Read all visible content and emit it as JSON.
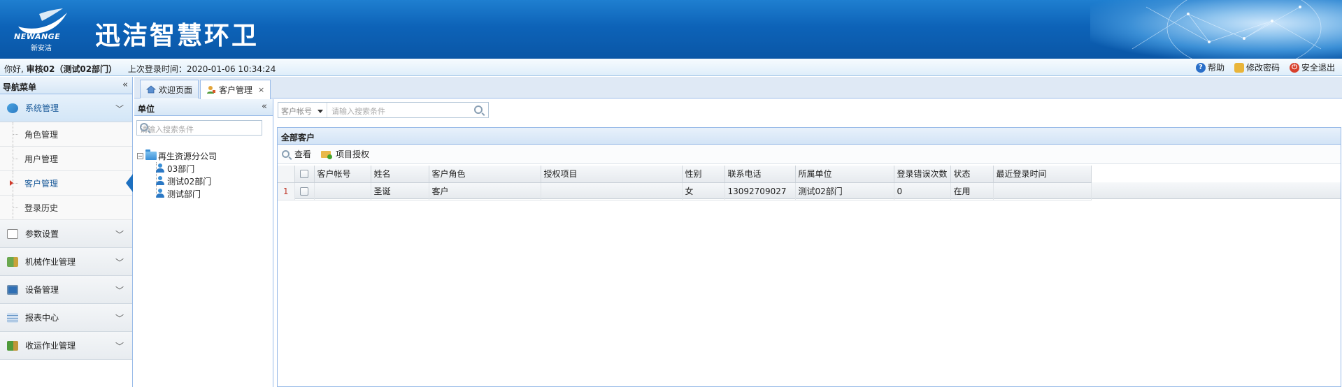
{
  "header": {
    "logo_word": "NEWANGE",
    "logo_cn": "新安洁",
    "title": "迅洁智慧环卫"
  },
  "infobar": {
    "greeting": "你好, ",
    "user": "审核02",
    "dept": "（测试02部门）",
    "last_login": "上次登录时间：2020-01-06 10:34:24",
    "links": [
      {
        "icon": "help-icon",
        "label": "帮助"
      },
      {
        "icon": "lock-icon",
        "label": "修改密码"
      },
      {
        "icon": "power-icon",
        "label": "安全退出"
      }
    ]
  },
  "nav": {
    "title": "导航菜单",
    "sections": [
      {
        "label": "系统管理",
        "icon": "system-icon",
        "expanded": true,
        "items": [
          "角色管理",
          "用户管理",
          "客户管理",
          "登录历史"
        ],
        "current": "客户管理"
      },
      {
        "label": "参数设置",
        "icon": "chart-icon"
      },
      {
        "label": "机械作业管理",
        "icon": "truck-icon"
      },
      {
        "label": "设备管理",
        "icon": "monitor-icon"
      },
      {
        "label": "报表中心",
        "icon": "report-icon"
      },
      {
        "label": "收运作业管理",
        "icon": "garbage-truck-icon"
      }
    ]
  },
  "tabs": [
    {
      "label": "欢迎页面",
      "icon": "home-icon",
      "active": false
    },
    {
      "label": "客户管理",
      "icon": "customer-icon",
      "active": true,
      "close": "×"
    }
  ],
  "unit_panel": {
    "title": "单位",
    "search_placeholder": "请输入搜索条件",
    "tree": {
      "root": "再生资源分公司",
      "children": [
        "03部门",
        "测试02部门",
        "测试部门"
      ]
    }
  },
  "filter": {
    "field": "客户帐号",
    "placeholder": "请输入搜索条件"
  },
  "grid": {
    "title": "全部客户",
    "toolbar": [
      {
        "label": "查看",
        "icon": "search-icon"
      },
      {
        "label": "项目授权",
        "icon": "folder-auth-icon"
      }
    ],
    "columns": [
      "客户帐号",
      "姓名",
      "客户角色",
      "授权项目",
      "性别",
      "联系电话",
      "所属单位",
      "登录错误次数",
      "状态",
      "最近登录时间"
    ],
    "rows": [
      {
        "rn": "1",
        "cells": [
          "",
          "圣诞",
          "客户",
          "",
          "女",
          "13092709027",
          "测试02部门",
          "0",
          "在用",
          ""
        ]
      }
    ]
  },
  "colors": {
    "banner": "#0d63b8",
    "accent": "#1d70c0",
    "border": "#99bbe8",
    "current_marker": "#d03a2a"
  }
}
